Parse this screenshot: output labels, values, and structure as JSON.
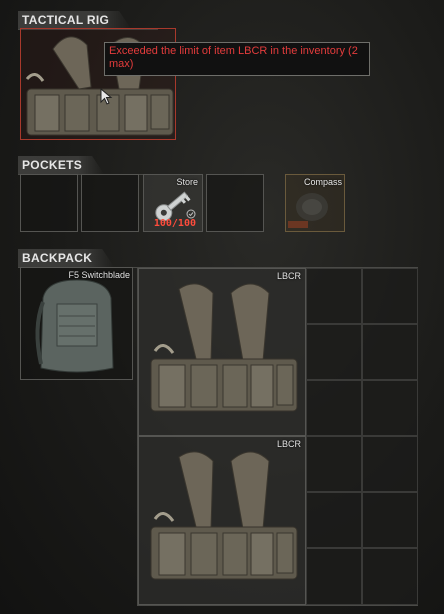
{
  "sections": {
    "rig": "TACTICAL RIG",
    "pockets": "POCKETS",
    "backpack": "BACKPACK"
  },
  "tooltip": {
    "message": "Exceeded the limit of item LBCR in the inventory (2 max)"
  },
  "pockets": {
    "items": [
      {
        "label": ""
      },
      {
        "label": ""
      },
      {
        "label": "Store",
        "counter": "100/100",
        "icon": "key-icon"
      },
      {
        "label": ""
      }
    ],
    "special": {
      "label": "Compass",
      "icon": "compass-icon"
    }
  },
  "backpack": {
    "item_label": "F5 Switchblade",
    "container_items": [
      {
        "label": "LBCR"
      },
      {
        "label": "LBCR"
      }
    ]
  },
  "colors": {
    "warning": "#e43c3c",
    "highlight_border": "#c0392b",
    "slot_border": "#555552"
  }
}
